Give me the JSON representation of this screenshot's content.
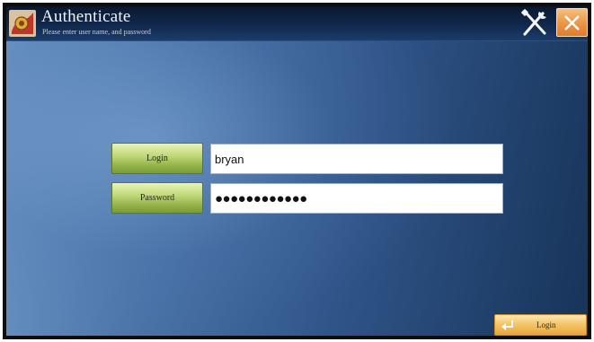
{
  "window": {
    "title": "Authenticate",
    "subtitle": "Please enter user name, and password",
    "tools_icon": "wrench-screwdriver-icon",
    "close_icon": "close-x-icon"
  },
  "form": {
    "login_label": "Login",
    "username_value": "bryan",
    "password_label": "Password",
    "password_value": "●●●●●●●●●●●●"
  },
  "footer": {
    "login_button_label": "Login",
    "login_icon": "enter-arrow-icon"
  },
  "colors": {
    "background": "#3a5f94",
    "titlebar": "#0f2244",
    "field_button": "#a8c25a",
    "close_button": "#ec9848",
    "login_button": "#f2bd5c"
  }
}
